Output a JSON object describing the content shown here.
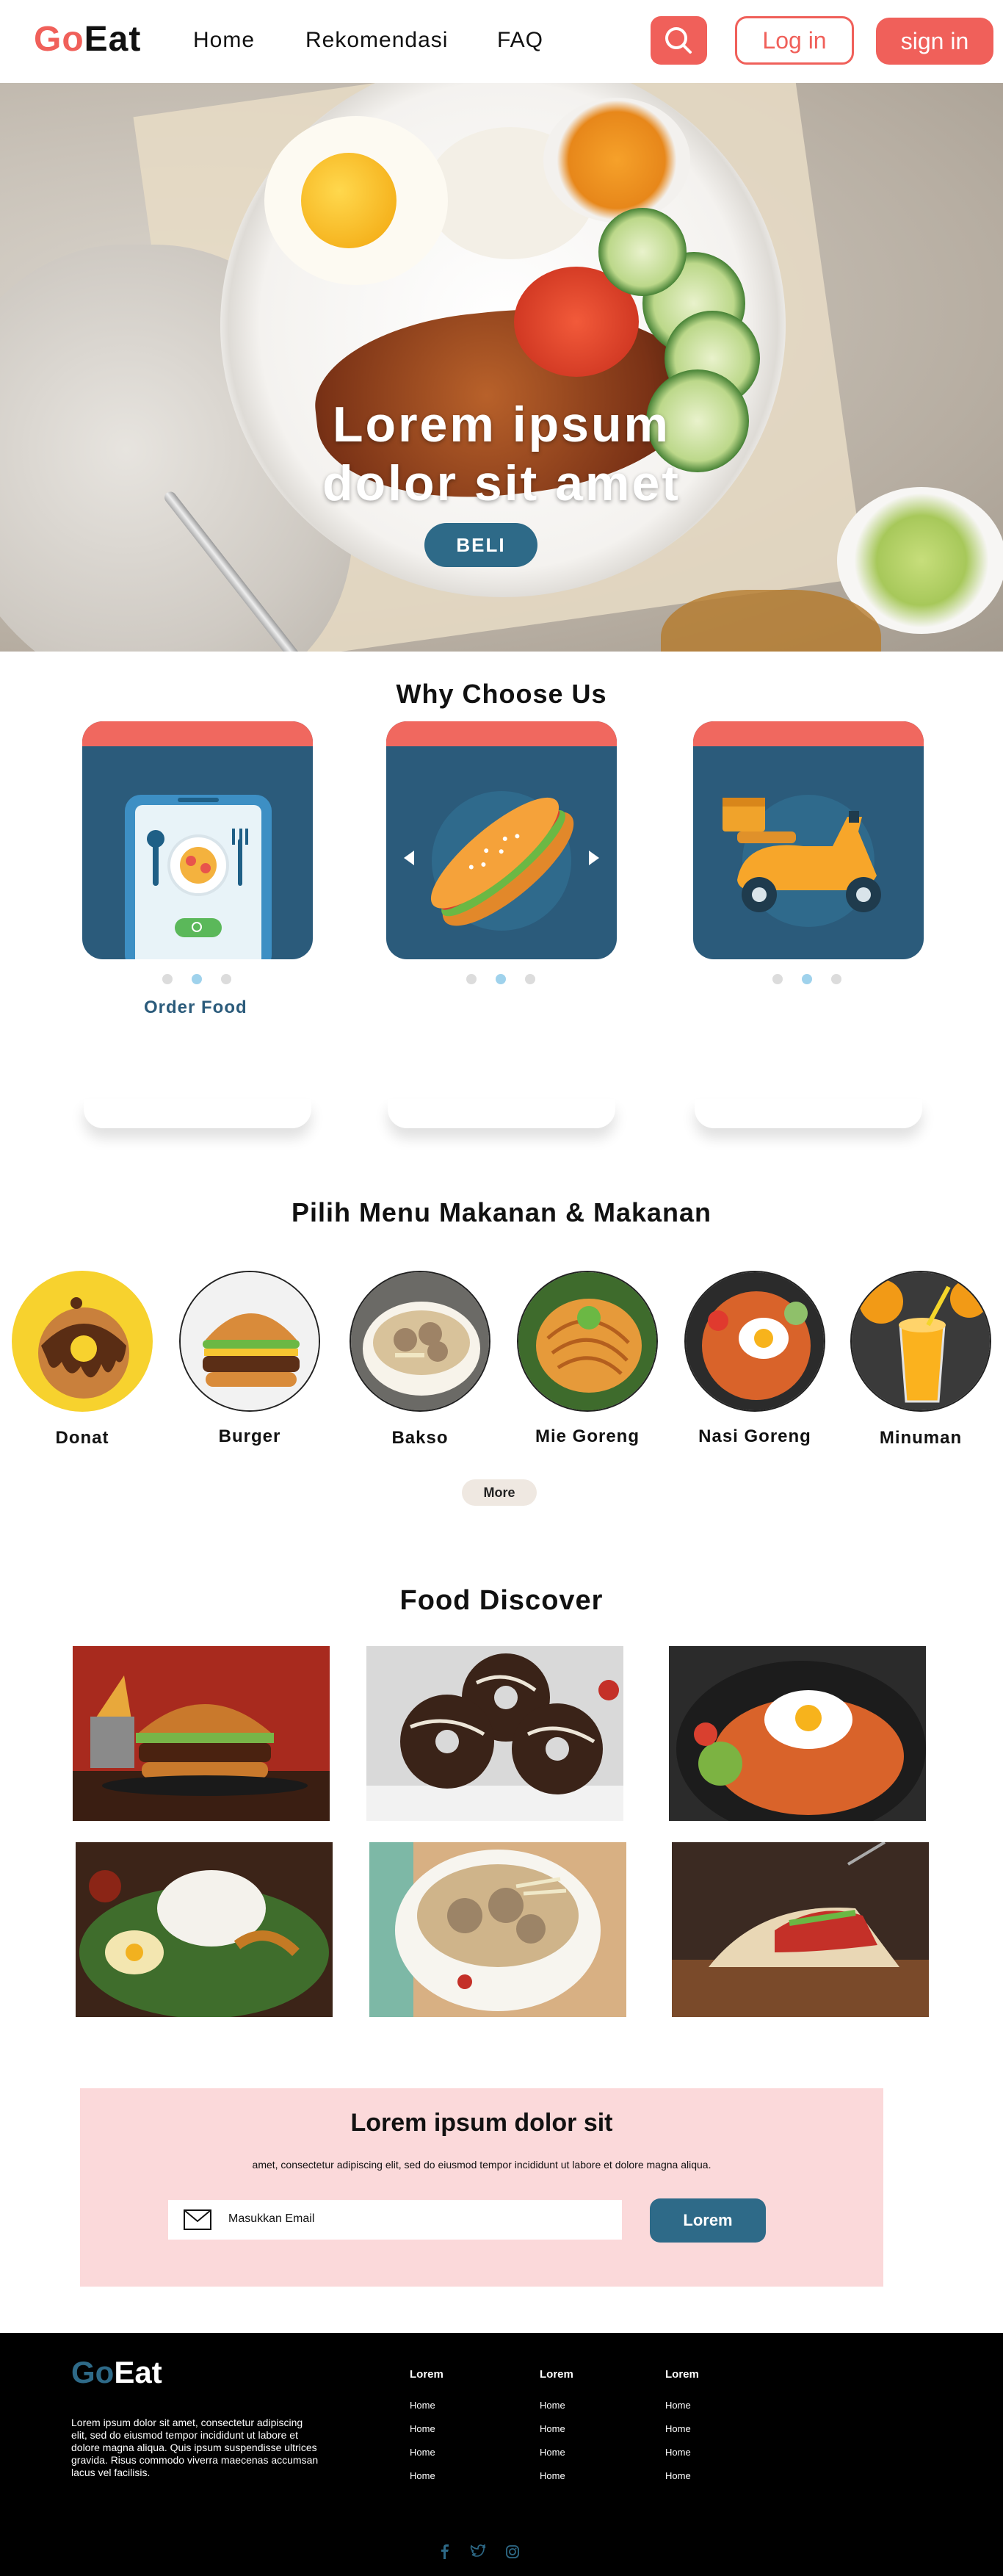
{
  "nav": {
    "logo_go": "Go",
    "logo_eat": "Eat",
    "links": [
      "Home",
      "Rekomendasi",
      "FAQ"
    ],
    "search_icon": "search-icon",
    "login_label": "Log in",
    "signin_label": "sign in"
  },
  "hero": {
    "title_line1": "Lorem ipsum",
    "title_line2": "dolor sit amet",
    "button_label": "BELI"
  },
  "why": {
    "title": "Why Choose Us",
    "cards": [
      {
        "icon": "phone-food-order-icon",
        "caption": "Order Food"
      },
      {
        "icon": "hotdog-icon",
        "caption": ""
      },
      {
        "icon": "delivery-scooter-icon",
        "caption": ""
      }
    ],
    "active_dot": 1
  },
  "menu": {
    "title": "Pilih Menu Makanan & Makanan",
    "items": [
      "Donat",
      "Burger",
      "Bakso",
      "Mie Goreng",
      "Nasi Goreng",
      "Minuman"
    ],
    "more_label": "More"
  },
  "discover": {
    "title": "Food Discover"
  },
  "newsletter": {
    "title": "Lorem ipsum dolor sit",
    "subtitle": "amet, consectetur adipiscing elit, sed do eiusmod tempor incididunt ut labore et dolore magna aliqua.",
    "placeholder": "Masukkan Email",
    "button_label": "Lorem"
  },
  "footer": {
    "logo_go": "Go",
    "logo_eat": "Eat",
    "description": "Lorem ipsum dolor sit amet, consectetur adipiscing elit, sed do eiusmod tempor incididunt ut labore et dolore magna aliqua. Quis ipsum suspendisse ultrices gravida. Risus commodo viverra maecenas accumsan lacus vel facilisis.",
    "columns": [
      {
        "heading": "Lorem",
        "links": [
          "Home",
          "Home",
          "Home",
          "Home"
        ]
      },
      {
        "heading": "Lorem",
        "links": [
          "Home",
          "Home",
          "Home",
          "Home"
        ]
      },
      {
        "heading": "Lorem",
        "links": [
          "Home",
          "Home",
          "Home",
          "Home"
        ]
      }
    ],
    "social": [
      "facebook-icon",
      "twitter-icon",
      "instagram-icon"
    ]
  },
  "colors": {
    "primary_coral": "#f0605a",
    "primary_blue": "#2e6a88",
    "card_blue": "#2b5b7b",
    "newsletter_bg": "#fbd9da",
    "footer_bg": "#000000"
  }
}
